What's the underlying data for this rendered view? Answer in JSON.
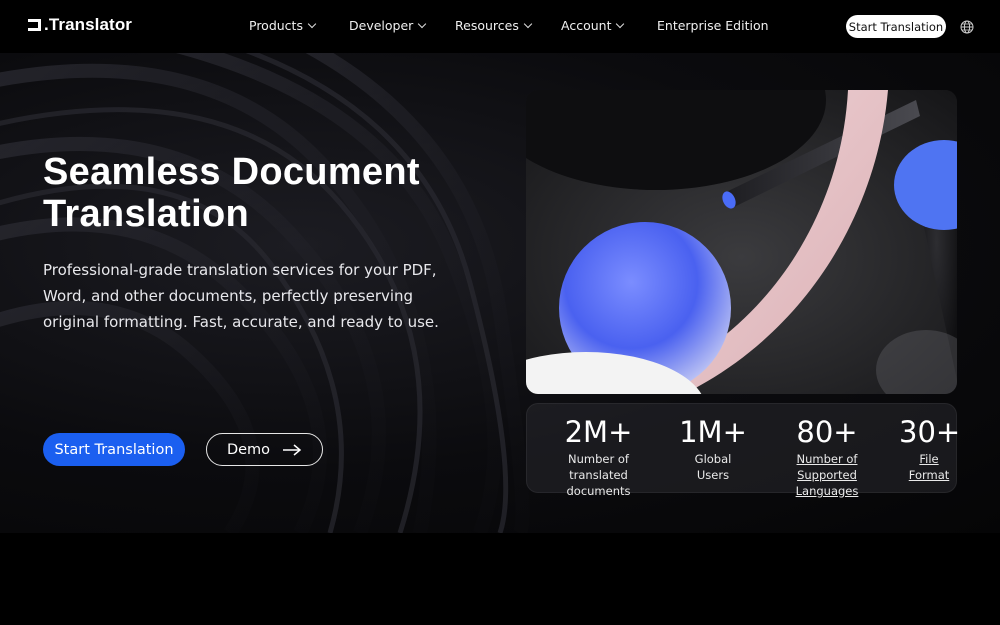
{
  "nav": {
    "logo_text": ".Translator",
    "items": [
      {
        "label": "Products",
        "has_menu": true
      },
      {
        "label": "Developer",
        "has_menu": true
      },
      {
        "label": "Resources",
        "has_menu": true
      },
      {
        "label": "Account",
        "has_menu": true
      },
      {
        "label": "Enterprise Edition",
        "has_menu": false
      }
    ],
    "cta_label": "Start Translation",
    "language_icon": "globe-icon"
  },
  "hero": {
    "title_line1": "Seamless Document",
    "title_line2": "Translation",
    "subtitle": "Professional-grade translation services for your PDF, Word, and other documents, perfectly preserving original formatting. Fast, accurate, and ready to use.",
    "primary_button": "Start Translation",
    "demo_button": "Demo"
  },
  "stats": [
    {
      "value": "2M+",
      "label_line1": "Number of translated",
      "label_line2": "documents",
      "link": false
    },
    {
      "value": "1M+",
      "label_line1": "Global",
      "label_line2": "Users",
      "link": false
    },
    {
      "value": "80+",
      "label_line1": "Number of Supported",
      "label_line2": "Languages",
      "link": true
    },
    {
      "value": "30+",
      "label_line1": "File",
      "label_line2": "Format",
      "link": true
    }
  ],
  "colors": {
    "accent": "#1b5ff0",
    "background": "#000000",
    "sphere_blue": "#4a6cf7",
    "arc_pink": "#e7c4c8"
  }
}
